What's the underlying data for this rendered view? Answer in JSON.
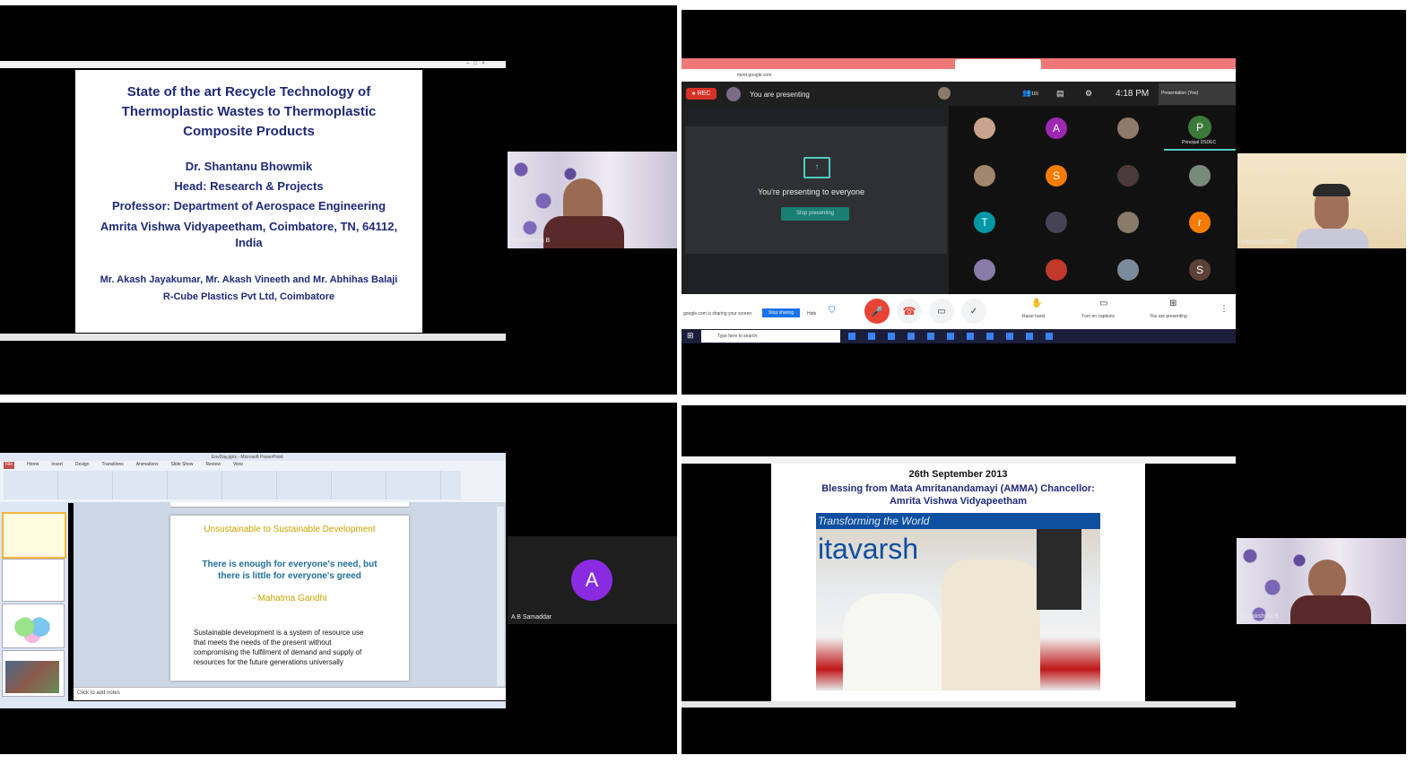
{
  "q1": {
    "title_line1": "State of the art Recycle Technology of",
    "title_line2": "Thermoplastic Wastes to Thermoplastic",
    "title_line3": "Composite Products",
    "author": "Dr. Shantanu Bhowmik",
    "role1": "Head: Research & Projects",
    "role2": "Professor: Department of Aerospace Engineering",
    "affil_line1": "Amrita Vishwa Vidyapeetham, Coimbatore, TN, 64112,",
    "affil_line2": "India",
    "coauthors": "Mr. Akash Jayakumar, Mr. Akash Vineeth and Mr. Abhihas Balaji",
    "company": "R-Cube Plastics Pvt Ltd, Coimbatore",
    "participant": "Sudakshina B"
  },
  "q2": {
    "rec_label": "REC",
    "presenting_status": "You are presenting",
    "presenting_to_everyone": "You're presenting to everyone",
    "stop_presenting": "Stop presenting",
    "participant_count": "101",
    "time": "4:18 PM",
    "host_tile_letter": "P",
    "host_tile_name": "Principal DSDEC",
    "tiles": [
      "",
      "A",
      "",
      "P",
      "",
      "S",
      "",
      "",
      "T",
      "",
      "",
      "r",
      "",
      "",
      "",
      "S"
    ],
    "raise_hand": "Raise hand",
    "turn_on_captions": "Turn on captions",
    "you_are_presenting": "You are presenting",
    "search_placeholder": "Type here to search",
    "side_participant": "Principal DSDEC",
    "share_bar_text": "google.com is sharing your screen",
    "share_bar_stop": "Stop sharing",
    "share_bar_hide": "Hide",
    "self_view_label": "Presentation (You)"
  },
  "q3": {
    "app_title": "EnvDay.pptx - Microsoft PowerPoint",
    "ribbon_tabs": [
      "File",
      "Home",
      "Insert",
      "Design",
      "Transitions",
      "Animations",
      "Slide Show",
      "Review",
      "View"
    ],
    "slide_title": "Unsustainable to Sustainable Development",
    "quote_line1": "There is enough for everyone's need, but",
    "quote_line2": "there is little for everyone's greed",
    "quote_author": "- Mahatma Gandhi",
    "body_line1": "Sustainable development  is a system of resource use",
    "body_line2": "that meets the needs of the present without",
    "body_line3": "compromising the fulfilment of demand and supply of",
    "body_line4": "resources for the future generations  universally",
    "notes_placeholder": "Click to add notes",
    "avatar_letter": "A",
    "avatar_name": "A B Samaddar"
  },
  "q4": {
    "date_line": "26th September 2013",
    "title_line1": "Blessing from Mata Amritanandamayi (AMMA) Chancellor:",
    "title_line2": "Amrita Vishwa Vidyapeetham",
    "photo_banner": "Transforming the World",
    "photo_word": "itavarsh",
    "participant": "Sudakshina B"
  }
}
